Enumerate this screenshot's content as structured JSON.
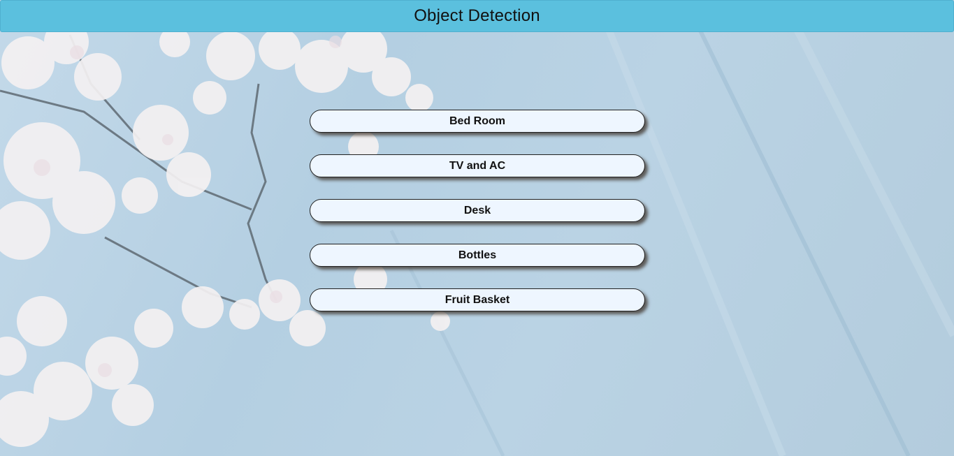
{
  "header": {
    "title": "Object Detection",
    "background_color": "#5bc0de"
  },
  "menu": {
    "items": [
      {
        "label": "Bed Room"
      },
      {
        "label": "TV and AC"
      },
      {
        "label": "Desk"
      },
      {
        "label": "Bottles"
      },
      {
        "label": "Fruit Basket"
      }
    ]
  },
  "background": {
    "description_icon": "cherry-blossom-branch-image"
  }
}
